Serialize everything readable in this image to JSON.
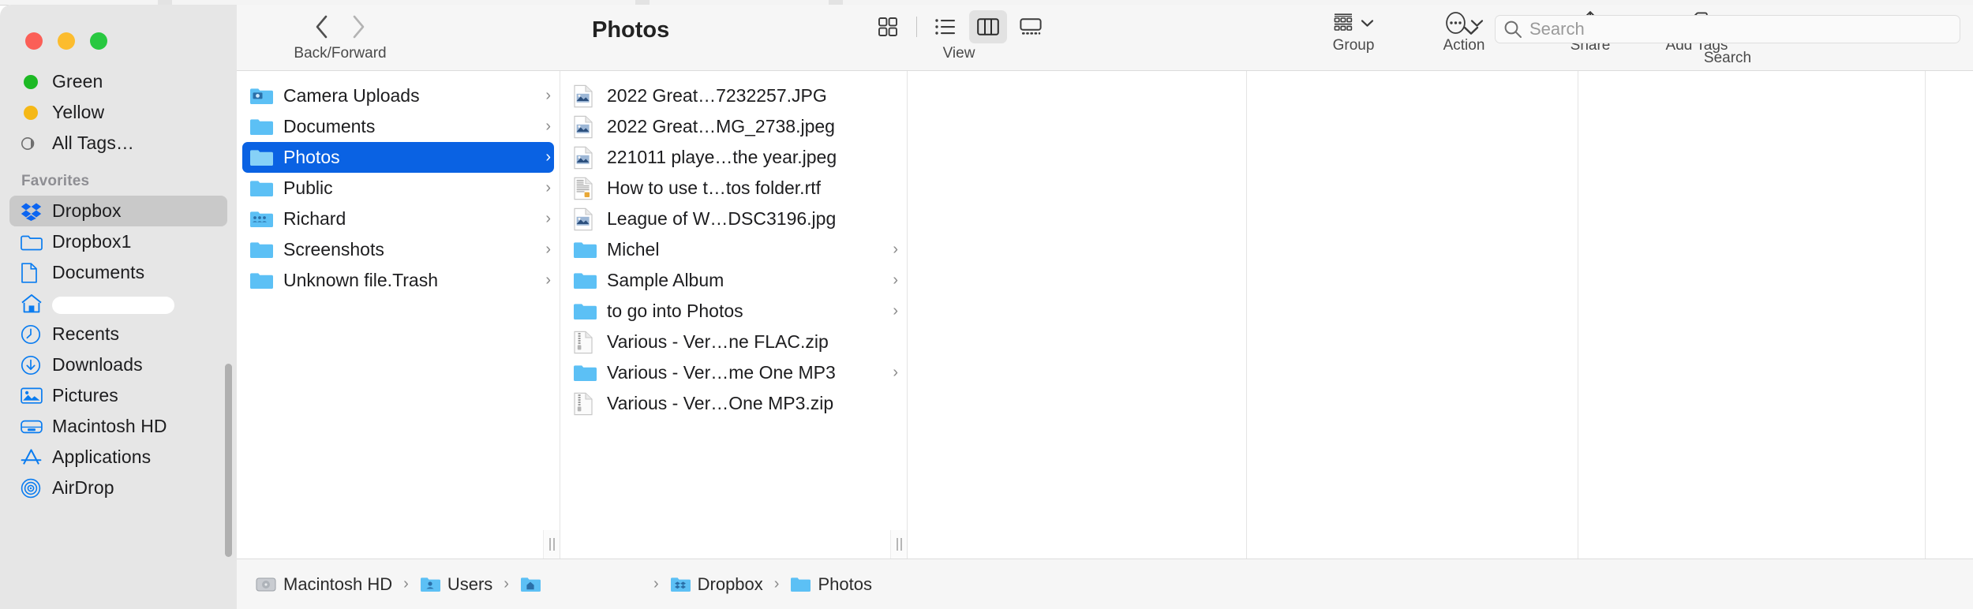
{
  "window": {
    "title": "Photos",
    "traffic_lights": [
      {
        "name": "close",
        "color": "#fb5f57"
      },
      {
        "name": "minimize",
        "color": "#fcbc2e"
      },
      {
        "name": "zoom",
        "color": "#28c840"
      }
    ]
  },
  "sidebar": {
    "tags": [
      {
        "label": "Green",
        "icon": "tag-dot",
        "color": "#1db924"
      },
      {
        "label": "Yellow",
        "icon": "tag-dot",
        "color": "#f5b816"
      },
      {
        "label": "All Tags…",
        "icon": "all-tags-icon",
        "color": "#8a8a8a"
      }
    ],
    "favorites_header": "Favorites",
    "favorites": [
      {
        "label": "Dropbox",
        "icon": "dropbox-icon",
        "selected": true
      },
      {
        "label": "Dropbox1",
        "icon": "folder-icon",
        "selected": false
      },
      {
        "label": "Documents",
        "icon": "document-icon",
        "selected": false
      },
      {
        "label": "",
        "icon": "home-icon",
        "selected": false,
        "redacted": true
      },
      {
        "label": "Recents",
        "icon": "clock-icon",
        "selected": false
      },
      {
        "label": "Downloads",
        "icon": "download-icon",
        "selected": false
      },
      {
        "label": "Pictures",
        "icon": "pictures-icon",
        "selected": false
      },
      {
        "label": "Macintosh HD",
        "icon": "harddisk-icon",
        "selected": false
      },
      {
        "label": "Applications",
        "icon": "applications-icon",
        "selected": false
      },
      {
        "label": "AirDrop",
        "icon": "airdrop-icon",
        "selected": false
      }
    ]
  },
  "toolbar": {
    "back_label": "Back/Forward",
    "back_icon": "chevron-left-icon",
    "forward_icon": "chevron-right-icon",
    "view_label": "View",
    "view_options": [
      {
        "name": "icon-view",
        "icon": "grid-icon",
        "active": false
      },
      {
        "name": "list-view",
        "icon": "list-icon",
        "active": false
      },
      {
        "name": "column-view",
        "icon": "columns-icon",
        "active": true
      },
      {
        "name": "gallery-view",
        "icon": "gallery-icon",
        "active": false
      }
    ],
    "group_label": "Group",
    "group_icon": "group-icon",
    "action_label": "Action",
    "action_icon": "ellipsis-circle-icon",
    "share_label": "Share",
    "share_icon": "share-icon",
    "addtags_label": "Add Tags",
    "addtags_icon": "tag-icon",
    "overflow_icon": "chevron-down-icon"
  },
  "search": {
    "placeholder": "Search",
    "value": "",
    "caption": "Search",
    "icon": "search-icon"
  },
  "columns": [
    {
      "name": "column-dropbox",
      "items": [
        {
          "label": "Camera Uploads",
          "icon": "folder-camera-icon",
          "arrow": true,
          "selected": false
        },
        {
          "label": "Documents",
          "icon": "folder-icon",
          "arrow": true,
          "selected": false
        },
        {
          "label": "Photos",
          "icon": "folder-icon",
          "arrow": true,
          "selected": true
        },
        {
          "label": "Public",
          "icon": "folder-icon",
          "arrow": true,
          "selected": false
        },
        {
          "label": "Richard",
          "icon": "folder-shared-icon",
          "arrow": true,
          "selected": false
        },
        {
          "label": "Screenshots",
          "icon": "folder-icon",
          "arrow": true,
          "selected": false
        },
        {
          "label": "Unknown file.Trash",
          "icon": "folder-icon",
          "arrow": true,
          "selected": false
        }
      ]
    },
    {
      "name": "column-photos",
      "items": [
        {
          "label": "2022 Great…7232257.JPG",
          "icon": "image-file-icon",
          "arrow": false,
          "selected": false
        },
        {
          "label": "2022 Great…MG_2738.jpeg",
          "icon": "image-file-icon",
          "arrow": false,
          "selected": false
        },
        {
          "label": "221011 playe…the year.jpeg",
          "icon": "image-file-icon",
          "arrow": false,
          "selected": false
        },
        {
          "label": "How to use t…tos folder.rtf",
          "icon": "rtf-file-icon",
          "arrow": false,
          "selected": false
        },
        {
          "label": "League of W…DSC3196.jpg",
          "icon": "image-file-icon",
          "arrow": false,
          "selected": false
        },
        {
          "label": "Michel",
          "icon": "folder-icon",
          "arrow": true,
          "selected": false
        },
        {
          "label": "Sample Album",
          "icon": "folder-icon",
          "arrow": true,
          "selected": false
        },
        {
          "label": "to go into Photos",
          "icon": "folder-icon",
          "arrow": true,
          "selected": false
        },
        {
          "label": "Various - Ver…ne FLAC.zip",
          "icon": "zip-file-icon",
          "arrow": false,
          "selected": false
        },
        {
          "label": "Various - Ver…me One MP3",
          "icon": "folder-icon",
          "arrow": true,
          "selected": false
        },
        {
          "label": "Various - Ver…One MP3.zip",
          "icon": "zip-file-icon",
          "arrow": false,
          "selected": false
        }
      ]
    },
    {
      "name": "column-empty-1",
      "items": []
    },
    {
      "name": "column-empty-2",
      "items": []
    },
    {
      "name": "column-empty-3",
      "items": []
    }
  ],
  "pathbar": {
    "items": [
      {
        "label": "Macintosh HD",
        "icon": "harddisk-icon"
      },
      {
        "label": "Users",
        "icon": "folder-users-icon"
      },
      {
        "label": "",
        "icon": "folder-home-icon",
        "redacted": true
      },
      {
        "label": "Dropbox",
        "icon": "folder-dropbox-icon"
      },
      {
        "label": "Photos",
        "icon": "folder-icon"
      }
    ],
    "separator": "›"
  },
  "colors": {
    "accent": "#0a62e3",
    "sidebar_bg": "#e6e6e6",
    "toolbar_bg": "#f6f6f6",
    "folder_blue": "#52b8f5"
  }
}
